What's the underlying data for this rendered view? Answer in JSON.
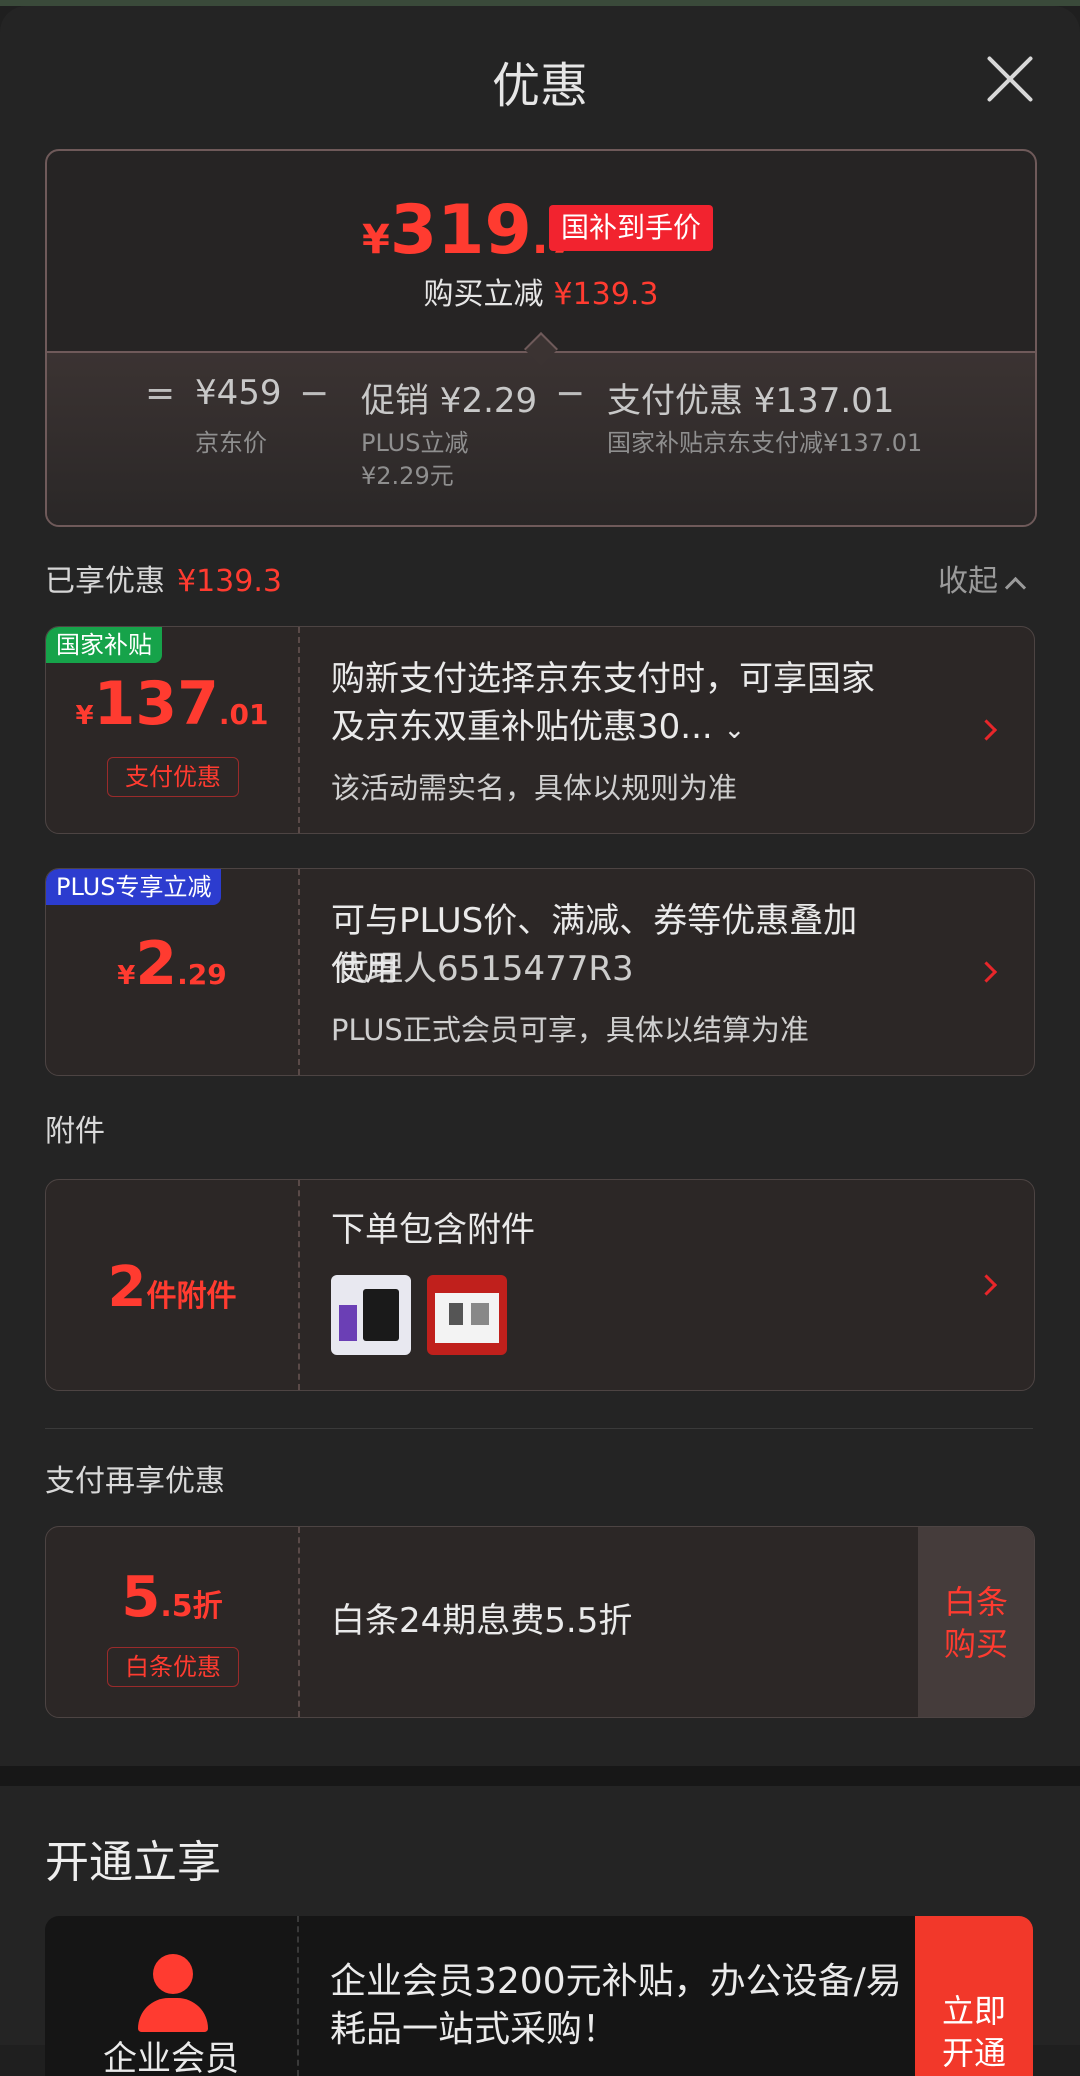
{
  "title": "优惠",
  "summary": {
    "currency": "¥",
    "price_int": "319",
    "price_dec": ".7",
    "tag": "国补到手价",
    "reduce_label": "购买立减",
    "reduce_amount": "¥139.3",
    "eq": "=",
    "minus": "−",
    "jd_price": "¥459",
    "jd_label": "京东价",
    "promo_price": "促销 ¥2.29",
    "promo_line1": "PLUS立减",
    "promo_line2": "¥2.29元",
    "pay_price": "支付优惠 ¥137.01",
    "pay_desc": "国家补贴京东支付减¥137.01"
  },
  "enjoyed": {
    "label": "已享优惠",
    "amount": "¥139.3",
    "collapse": "收起"
  },
  "cards": [
    {
      "badge": "国家补贴",
      "currency": "¥",
      "int": "137",
      "dec": ".01",
      "tag": "支付优惠",
      "line1": "购新支付选择京东支付时，可享国家",
      "line2": "及京东双重补贴优惠30...",
      "sub": "该活动需实名，具体以规则为准"
    },
    {
      "badge": "PLUS专享立减",
      "currency": "¥",
      "int": "2",
      "dec": ".29",
      "line1": "可与PLUS价、满减、券等优惠叠加",
      "line2": "使用",
      "overlay": "代理人6515477R3",
      "sub": "PLUS正式会员可享，具体以结算为准"
    }
  ],
  "accessories": {
    "section": "附件",
    "count": "2",
    "unit": "件附件",
    "title": "下单包含附件"
  },
  "pay_more": {
    "section": "支付再享优惠",
    "int": "5",
    "dec": ".5折",
    "tag": "白条优惠",
    "text": "白条24期息费5.5折",
    "btn_line1": "白条",
    "btn_line2": "购买"
  },
  "open": {
    "title": "开通立享",
    "label": "企业会员",
    "text": "企业会员3200元补贴，办公设备/易耗品一站式采购！",
    "btn_line1": "立即",
    "btn_line2": "开通"
  }
}
